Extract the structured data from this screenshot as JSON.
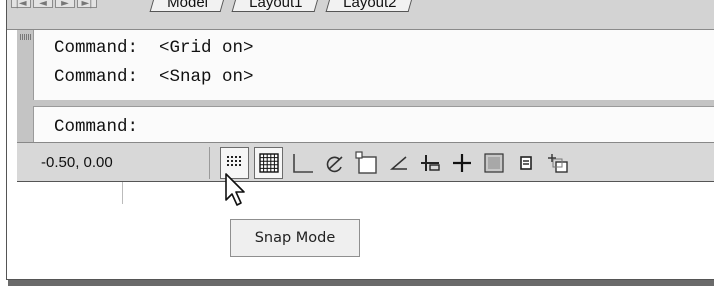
{
  "layout_tabs": {
    "nav_buttons": [
      "|◄",
      "◄",
      "►",
      "►|"
    ],
    "tabs": [
      "Model",
      "Layout1",
      "Layout2"
    ]
  },
  "command_window": {
    "history": [
      "Command:  <Grid on>",
      "Command:  <Snap on>"
    ],
    "prompt": "Command:"
  },
  "status_bar": {
    "coordinates": "-0.50, 0.00",
    "toggle_buttons": [
      {
        "name": "snap-mode-icon",
        "on": true
      },
      {
        "name": "grid-display-icon",
        "on": true
      },
      {
        "name": "ortho-mode-icon",
        "on": false
      },
      {
        "name": "polar-tracking-icon",
        "on": false
      },
      {
        "name": "object-snap-icon",
        "on": false
      },
      {
        "name": "object-snap-tracking-icon",
        "on": false
      },
      {
        "name": "dynamic-ucs-icon",
        "on": false
      },
      {
        "name": "dynamic-input-icon",
        "on": false
      },
      {
        "name": "lineweight-icon",
        "on": false
      },
      {
        "name": "quick-properties-icon",
        "on": false
      },
      {
        "name": "selection-cycling-icon",
        "on": false
      }
    ]
  },
  "tooltip": {
    "text": "Snap Mode"
  },
  "colors": {
    "background": "#ffffff",
    "status_bar": "#d8d8d8",
    "command_bg": "#fbfbfb",
    "tooltip_bg": "#efefef"
  }
}
